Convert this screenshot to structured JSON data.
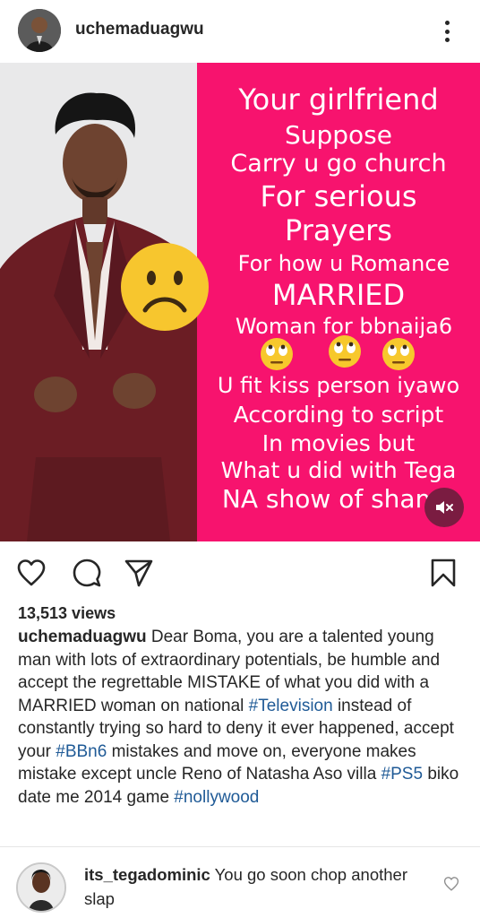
{
  "header": {
    "username": "uchemaduagwu"
  },
  "post_image": {
    "text_lines": [
      "Your girlfriend",
      "Suppose",
      "Carry u go church",
      "For serious",
      "Prayers",
      "For how u Romance",
      "MARRIED",
      "Woman for bbnaija6",
      "U fit kiss person iyawo",
      "According to script",
      "In movies but",
      "What u did with Tega",
      "NA show of shame"
    ],
    "background_color": "#f7136e",
    "emojis": [
      "sad-face",
      "eye-roll",
      "eye-roll",
      "eye-roll"
    ]
  },
  "actions": {
    "icons": [
      "heart-icon",
      "comment-icon",
      "share-icon",
      "bookmark-icon"
    ]
  },
  "views": "13,513 views",
  "caption": {
    "username": "uchemaduagwu",
    "text_1": " Dear Boma, you are a talented young man with lots of extraordinary potentials, be humble and accept the regrettable MISTAKE of what you did with a MARRIED woman on national ",
    "tag_1": "#Television",
    "text_2": " instead of constantly trying so hard to deny it ever happened, accept your ",
    "tag_2": "#BBn6",
    "text_3": " mistakes and move on, everyone makes mistake except uncle Reno of Natasha Aso villa ",
    "tag_3": "#PS5",
    "text_4": " biko date me 2014 game ",
    "tag_4": "#nollywood"
  },
  "comment": {
    "username": "its_tegadominic",
    "text": " You go soon chop another slap"
  }
}
